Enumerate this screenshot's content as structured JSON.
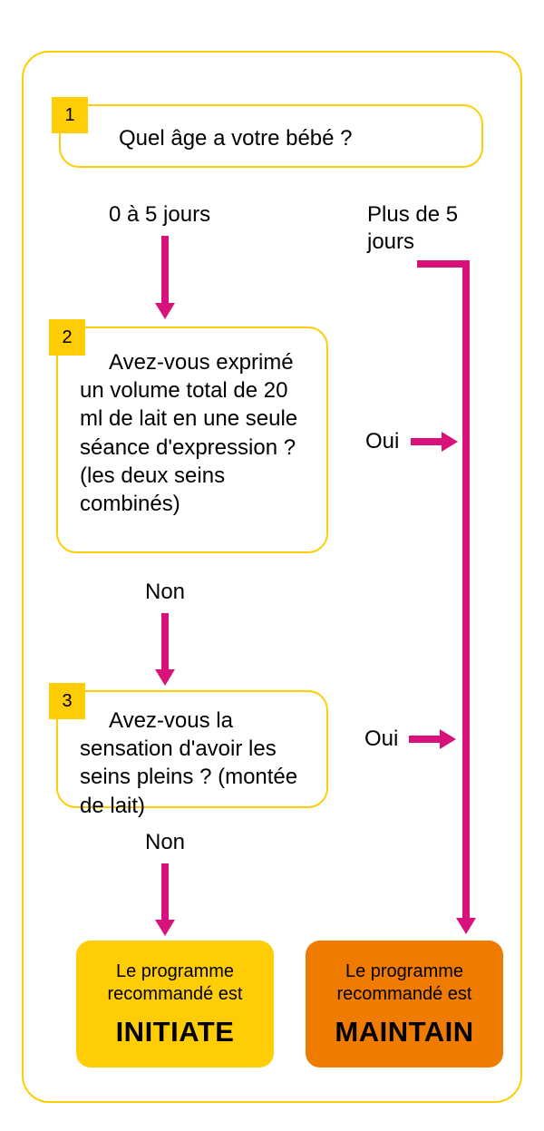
{
  "frame": {},
  "q1": {
    "badge": "1",
    "text": "Quel âge a votre bébé ?"
  },
  "labels": {
    "age_0_5": "0 à 5 jours",
    "age_plus5": "Plus de 5 jours",
    "non": "Non",
    "oui": "Oui"
  },
  "q2": {
    "badge": "2",
    "text": "Avez-vous exprimé un volume total de 20 ml de lait en une seule séance d'expression ? (les deux seins combinés)"
  },
  "q3": {
    "badge": "3",
    "text": "Avez-vous la sensation d'avoir les seins pleins ? (montée de lait)"
  },
  "results": {
    "intro": "Le programme recommandé est",
    "initiate": "INITIATE",
    "maintain": "MAINTAIN"
  },
  "colors": {
    "yellow": "#ffcd05",
    "orange": "#ef7b00",
    "magenta": "#d8117b"
  }
}
